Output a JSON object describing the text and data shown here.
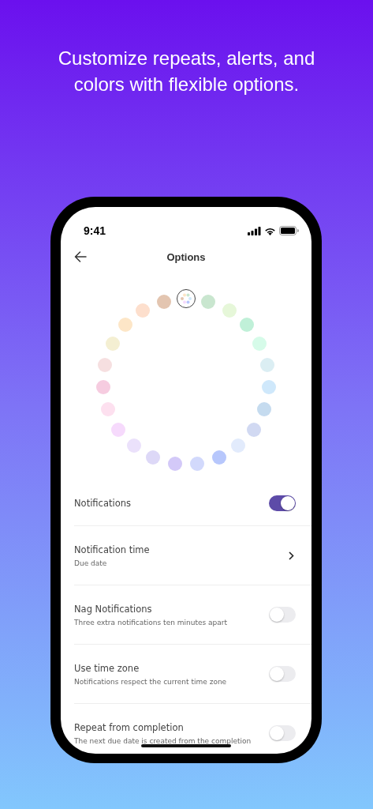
{
  "headline": "Customize repeats, alerts, and colors with flexible options.",
  "status_bar": {
    "time": "9:41"
  },
  "nav": {
    "title": "Options"
  },
  "color_picker": [
    {
      "kind": "multicolor",
      "selected": true
    },
    {
      "kind": "swatch",
      "color": "#c9e6cf",
      "selected": false
    },
    {
      "kind": "swatch",
      "color": "#e6f7d9",
      "selected": false
    },
    {
      "kind": "swatch",
      "color": "#c0f0d8",
      "selected": false
    },
    {
      "kind": "swatch",
      "color": "#d6fbe9",
      "selected": false
    },
    {
      "kind": "swatch",
      "color": "#dbeef3",
      "selected": false
    },
    {
      "kind": "swatch",
      "color": "#cfe8fb",
      "selected": false
    },
    {
      "kind": "swatch",
      "color": "#c5dbef",
      "selected": false
    },
    {
      "kind": "swatch",
      "color": "#d1d9f2",
      "selected": false
    },
    {
      "kind": "swatch",
      "color": "#e2ebfc",
      "selected": false
    },
    {
      "kind": "swatch",
      "color": "#b7c7fc",
      "selected": false
    },
    {
      "kind": "swatch",
      "color": "#d2d9fc",
      "selected": false
    },
    {
      "kind": "swatch",
      "color": "#d3c9f8",
      "selected": false
    },
    {
      "kind": "swatch",
      "color": "#ddd8f7",
      "selected": false
    },
    {
      "kind": "swatch",
      "color": "#ebe1fb",
      "selected": false
    },
    {
      "kind": "swatch",
      "color": "#f6dafc",
      "selected": false
    },
    {
      "kind": "swatch",
      "color": "#fde0ef",
      "selected": false
    },
    {
      "kind": "swatch",
      "color": "#f6cce0",
      "selected": false
    },
    {
      "kind": "swatch",
      "color": "#f6dfe0",
      "selected": false
    },
    {
      "kind": "swatch",
      "color": "#f4efd2",
      "selected": false
    },
    {
      "kind": "swatch",
      "color": "#fde6c7",
      "selected": false
    },
    {
      "kind": "swatch",
      "color": "#fddfcd",
      "selected": false
    },
    {
      "kind": "swatch",
      "color": "#e3c5b0",
      "selected": false
    }
  ],
  "settings": [
    {
      "kind": "toggle",
      "label": "Notifications",
      "on": true
    },
    {
      "kind": "link",
      "label": "Notification time",
      "detail": "Due date"
    },
    {
      "kind": "toggle",
      "label": "Nag Notifications",
      "detail": "Three extra notifications ten minutes apart",
      "on": false
    },
    {
      "kind": "toggle",
      "label": "Use time zone",
      "detail": "Notifications respect the current time zone",
      "on": false
    },
    {
      "kind": "toggle",
      "label": "Repeat from completion",
      "detail": "The next due date is created from the completion",
      "on": false
    }
  ]
}
